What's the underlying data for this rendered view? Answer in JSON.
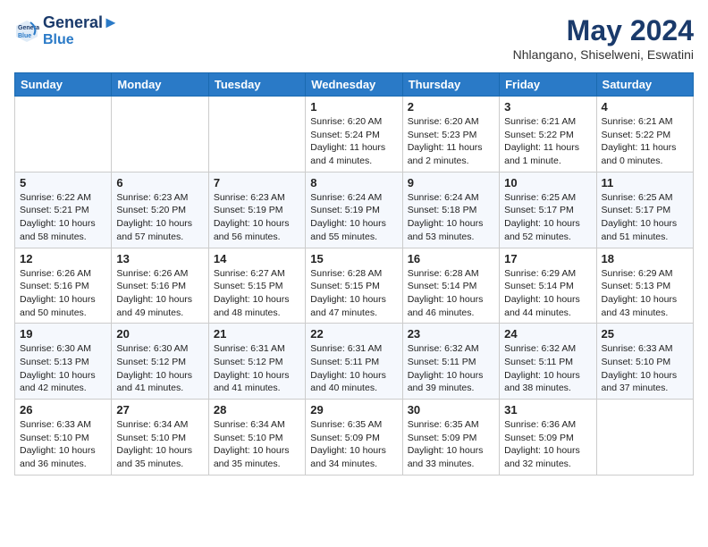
{
  "logo": {
    "line1": "General",
    "line2": "Blue"
  },
  "title": "May 2024",
  "location": "Nhlangano, Shiselweni, Eswatini",
  "days_of_week": [
    "Sunday",
    "Monday",
    "Tuesday",
    "Wednesday",
    "Thursday",
    "Friday",
    "Saturday"
  ],
  "weeks": [
    [
      {
        "day": "",
        "content": ""
      },
      {
        "day": "",
        "content": ""
      },
      {
        "day": "",
        "content": ""
      },
      {
        "day": "1",
        "content": "Sunrise: 6:20 AM\nSunset: 5:24 PM\nDaylight: 11 hours and 4 minutes."
      },
      {
        "day": "2",
        "content": "Sunrise: 6:20 AM\nSunset: 5:23 PM\nDaylight: 11 hours and 2 minutes."
      },
      {
        "day": "3",
        "content": "Sunrise: 6:21 AM\nSunset: 5:22 PM\nDaylight: 11 hours and 1 minute."
      },
      {
        "day": "4",
        "content": "Sunrise: 6:21 AM\nSunset: 5:22 PM\nDaylight: 11 hours and 0 minutes."
      }
    ],
    [
      {
        "day": "5",
        "content": "Sunrise: 6:22 AM\nSunset: 5:21 PM\nDaylight: 10 hours and 58 minutes."
      },
      {
        "day": "6",
        "content": "Sunrise: 6:23 AM\nSunset: 5:20 PM\nDaylight: 10 hours and 57 minutes."
      },
      {
        "day": "7",
        "content": "Sunrise: 6:23 AM\nSunset: 5:19 PM\nDaylight: 10 hours and 56 minutes."
      },
      {
        "day": "8",
        "content": "Sunrise: 6:24 AM\nSunset: 5:19 PM\nDaylight: 10 hours and 55 minutes."
      },
      {
        "day": "9",
        "content": "Sunrise: 6:24 AM\nSunset: 5:18 PM\nDaylight: 10 hours and 53 minutes."
      },
      {
        "day": "10",
        "content": "Sunrise: 6:25 AM\nSunset: 5:17 PM\nDaylight: 10 hours and 52 minutes."
      },
      {
        "day": "11",
        "content": "Sunrise: 6:25 AM\nSunset: 5:17 PM\nDaylight: 10 hours and 51 minutes."
      }
    ],
    [
      {
        "day": "12",
        "content": "Sunrise: 6:26 AM\nSunset: 5:16 PM\nDaylight: 10 hours and 50 minutes."
      },
      {
        "day": "13",
        "content": "Sunrise: 6:26 AM\nSunset: 5:16 PM\nDaylight: 10 hours and 49 minutes."
      },
      {
        "day": "14",
        "content": "Sunrise: 6:27 AM\nSunset: 5:15 PM\nDaylight: 10 hours and 48 minutes."
      },
      {
        "day": "15",
        "content": "Sunrise: 6:28 AM\nSunset: 5:15 PM\nDaylight: 10 hours and 47 minutes."
      },
      {
        "day": "16",
        "content": "Sunrise: 6:28 AM\nSunset: 5:14 PM\nDaylight: 10 hours and 46 minutes."
      },
      {
        "day": "17",
        "content": "Sunrise: 6:29 AM\nSunset: 5:14 PM\nDaylight: 10 hours and 44 minutes."
      },
      {
        "day": "18",
        "content": "Sunrise: 6:29 AM\nSunset: 5:13 PM\nDaylight: 10 hours and 43 minutes."
      }
    ],
    [
      {
        "day": "19",
        "content": "Sunrise: 6:30 AM\nSunset: 5:13 PM\nDaylight: 10 hours and 42 minutes."
      },
      {
        "day": "20",
        "content": "Sunrise: 6:30 AM\nSunset: 5:12 PM\nDaylight: 10 hours and 41 minutes."
      },
      {
        "day": "21",
        "content": "Sunrise: 6:31 AM\nSunset: 5:12 PM\nDaylight: 10 hours and 41 minutes."
      },
      {
        "day": "22",
        "content": "Sunrise: 6:31 AM\nSunset: 5:11 PM\nDaylight: 10 hours and 40 minutes."
      },
      {
        "day": "23",
        "content": "Sunrise: 6:32 AM\nSunset: 5:11 PM\nDaylight: 10 hours and 39 minutes."
      },
      {
        "day": "24",
        "content": "Sunrise: 6:32 AM\nSunset: 5:11 PM\nDaylight: 10 hours and 38 minutes."
      },
      {
        "day": "25",
        "content": "Sunrise: 6:33 AM\nSunset: 5:10 PM\nDaylight: 10 hours and 37 minutes."
      }
    ],
    [
      {
        "day": "26",
        "content": "Sunrise: 6:33 AM\nSunset: 5:10 PM\nDaylight: 10 hours and 36 minutes."
      },
      {
        "day": "27",
        "content": "Sunrise: 6:34 AM\nSunset: 5:10 PM\nDaylight: 10 hours and 35 minutes."
      },
      {
        "day": "28",
        "content": "Sunrise: 6:34 AM\nSunset: 5:10 PM\nDaylight: 10 hours and 35 minutes."
      },
      {
        "day": "29",
        "content": "Sunrise: 6:35 AM\nSunset: 5:09 PM\nDaylight: 10 hours and 34 minutes."
      },
      {
        "day": "30",
        "content": "Sunrise: 6:35 AM\nSunset: 5:09 PM\nDaylight: 10 hours and 33 minutes."
      },
      {
        "day": "31",
        "content": "Sunrise: 6:36 AM\nSunset: 5:09 PM\nDaylight: 10 hours and 32 minutes."
      },
      {
        "day": "",
        "content": ""
      }
    ]
  ]
}
